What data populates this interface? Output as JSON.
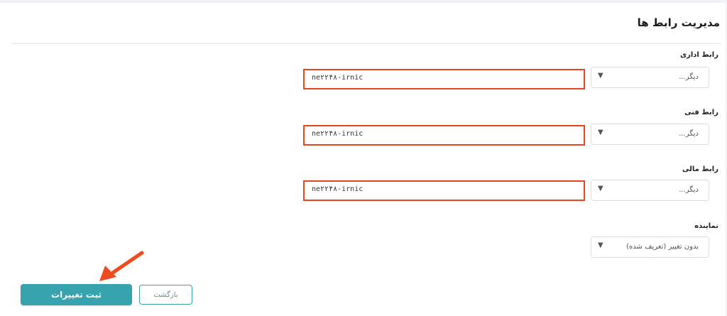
{
  "page": {
    "title": "مدیریت رابط ها"
  },
  "contacts": [
    {
      "label": "رابط اداری",
      "select_value": "دیگر...",
      "input_value": "ne۲۲۴۸-irnic"
    },
    {
      "label": "رابط فنی",
      "select_value": "دیگر...",
      "input_value": "ne۲۲۴۸-irnic"
    },
    {
      "label": "رابط مالی",
      "select_value": "دیگر...",
      "input_value": "ne۲۲۴۸-irnic"
    }
  ],
  "representative": {
    "label": "نماینده",
    "select_value": "بدون تغییر (تعریف شده)"
  },
  "actions": {
    "save_label": "ثبت تغییرات",
    "back_label": "بازگشت"
  },
  "colors": {
    "accent": "#36a3ae",
    "highlight": "#e8461f"
  },
  "icons": {
    "caret": "dropdown-caret-icon",
    "annotation": "red-arrow-icon"
  }
}
